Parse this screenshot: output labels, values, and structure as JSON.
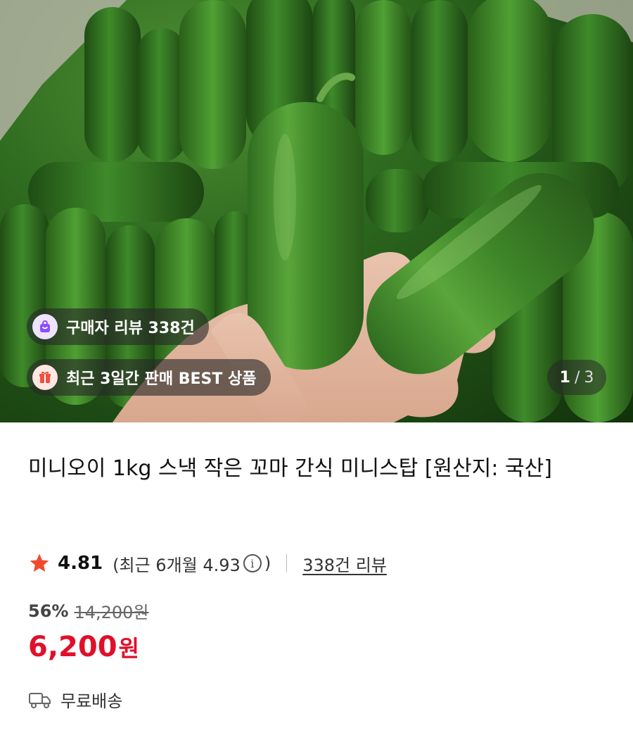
{
  "hero": {
    "badges": {
      "reviews": "구매자 리뷰 338건",
      "best": "최근 3일간 판매 BEST 상품"
    },
    "pager": {
      "current": "1",
      "separator": "/",
      "total": "3"
    }
  },
  "product": {
    "title": "미니오이 1kg 스낵 작은 꼬마 간식 미니스탑 [원산지: 국산]",
    "rating": {
      "score": "4.81",
      "recent_open": "(최근 6개월 4.93",
      "recent_close": ")",
      "reviews_link": "338건 리뷰"
    },
    "price": {
      "discount": "56%",
      "original": "14,200원",
      "sale_number": "6,200",
      "sale_unit": "원"
    },
    "shipping": "무료배송"
  },
  "colors": {
    "sale_price": "#e0102a",
    "star": "#f04a2c",
    "review_badge_icon": "#8b4dff",
    "best_badge_icon": "#f0503c"
  },
  "icons": {
    "reviews_badge": "shopping-bag-icon",
    "best_badge": "gift-icon",
    "rating": "star-icon",
    "info": "info-icon",
    "shipping": "truck-icon"
  }
}
